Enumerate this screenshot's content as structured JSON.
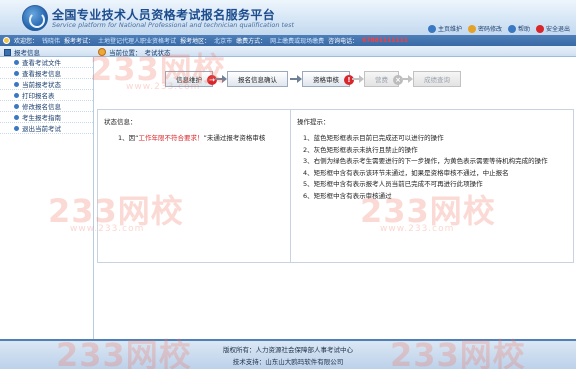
{
  "header": {
    "title": "全国专业技术人员资格考试报名服务平台",
    "subtitle": "Service platform for National Professional and technician qualification test",
    "links": [
      {
        "label": "主页维护",
        "icon": "home-icon",
        "color": "#3a78c2"
      },
      {
        "label": "密码修改",
        "icon": "key-icon",
        "color": "#e3a32a"
      },
      {
        "label": "帮助",
        "icon": "help-icon",
        "color": "#3a78c2"
      },
      {
        "label": "安全退出",
        "icon": "logout-icon",
        "color": "#d8262a"
      }
    ]
  },
  "infobar": {
    "welcome_label": "欢迎您：",
    "welcome_value": "钱晓伟",
    "exam_label": "报考考试：",
    "exam_value": "土地登记代理人职业资格考试",
    "region_label": "报考地区：",
    "region_value": "北京市",
    "fee_label": "缴费方式：",
    "fee_value": "网上缴费或现场缴费",
    "phone_label": "咨询电话：",
    "phone_value": "67881111111"
  },
  "tabs": {
    "left_label": "报考信息",
    "right_label_prefix": "当前位置：",
    "right_label": "考试状态"
  },
  "sidebar": {
    "items": [
      {
        "label": "查看考试文件"
      },
      {
        "label": "查看报考信息"
      },
      {
        "label": "当前报考状态"
      },
      {
        "label": "打印报名表"
      },
      {
        "label": "修改报名信息"
      },
      {
        "label": "考生报考指南"
      },
      {
        "label": "退出当前考试"
      }
    ]
  },
  "steps": [
    {
      "label": "信息维护",
      "state": "done",
      "badge": "arrow"
    },
    {
      "label": "报名信息确认",
      "state": "done",
      "badge": ""
    },
    {
      "label": "资格审核",
      "state": "current",
      "badge": "!"
    },
    {
      "label": "营费",
      "state": "disabled",
      "badge": "x"
    },
    {
      "label": "成绩查询",
      "state": "disabled",
      "badge": ""
    }
  ],
  "status_panel": {
    "title": "状态信息：",
    "line_prefix": "1、因“",
    "line_highlight": "工作年限不符合要求！",
    "line_suffix": "”未通过报考资格审核"
  },
  "tips_panel": {
    "title": "操作提示：",
    "tips": [
      "1、蓝色矩形框表示目前已完成还可以进行的操作",
      "2、灰色矩形框表示未执行且禁止的操作",
      "3、右侧为绿色表示考生需要进行的下一步操作，为黄色表示需要等待机构完成的操作",
      "4、矩形框中含有表示该环节未通过，如果是资格审核不通过，中止报名",
      "5、矩形框中含有表示报考人员当前已完成不可再进行此项操作",
      "6、矩形框中含有表示审核通过"
    ]
  },
  "footer": {
    "line1": "版权所有：人力资源社会保障部人事考试中心",
    "line2": "技术支持：山东山大鸥玛软件有限公司"
  },
  "watermark": {
    "brand": "233网校",
    "url": "www.233.com"
  },
  "colors": {
    "brand_blue": "#1c4c8d",
    "bar_blue": "#3a6aa6",
    "alert_red": "#d8262a",
    "watermark": "#f07864"
  }
}
